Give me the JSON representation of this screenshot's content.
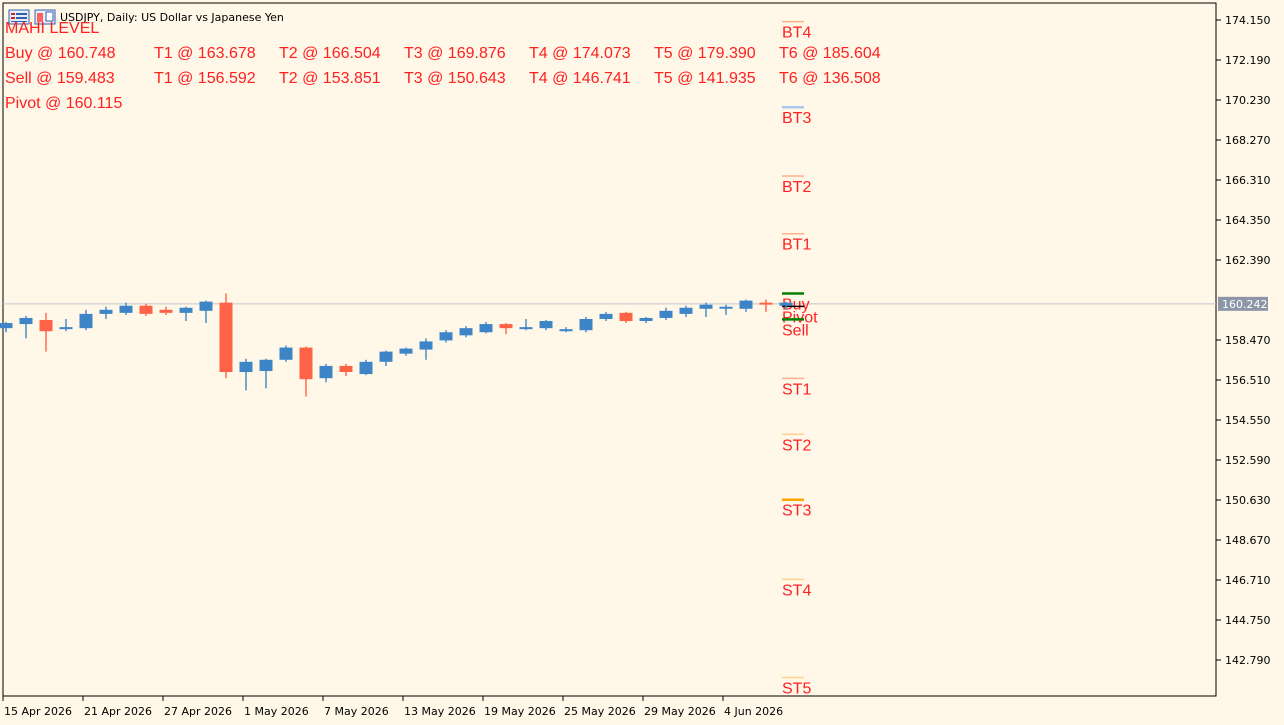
{
  "header": {
    "symbol_title": "USDJPY, Daily:  US Dollar vs Japanese Yen",
    "indicator_name": "MAHI LEVEL",
    "icons": [
      "indicator-list-icon",
      "chart-window-icon"
    ]
  },
  "levels_panel": {
    "rows": [
      [
        "Buy @ 160.748",
        "T1 @ 163.678",
        "T2 @ 166.504",
        "T3 @ 169.876",
        "T4 @ 174.073",
        "T5 @ 179.390",
        "T6 @ 185.604"
      ],
      [
        "Sell @ 159.483",
        "T1 @ 156.592",
        "T2 @ 153.851",
        "T3 @ 150.643",
        "T4 @ 146.741",
        "T5 @ 141.935",
        "T6 @ 136.508"
      ],
      [
        "Pivot @ 160.115"
      ]
    ]
  },
  "colors": {
    "background": "#fff8e8",
    "bull": "#3d85c6",
    "bear": "#ff6347",
    "level_text": "#ff2020",
    "current_price_bg": "#8c96a8",
    "buy_line": "#008000",
    "st3_line": "#ffa500"
  },
  "chart_data": {
    "type": "candlestick",
    "title": "USDJPY, Daily:  US Dollar vs Japanese Yen",
    "ylim": [
      141.2,
      175.6
    ],
    "yticks": [
      174.15,
      172.19,
      170.23,
      168.27,
      166.31,
      164.35,
      162.39,
      158.47,
      156.51,
      154.55,
      152.59,
      150.63,
      148.67,
      146.71,
      144.75,
      142.79
    ],
    "ytick_labels": [
      "174.150",
      "172.190",
      "170.230",
      "168.270",
      "166.310",
      "164.350",
      "162.390",
      "158.470",
      "156.510",
      "154.550",
      "152.590",
      "150.630",
      "148.670",
      "146.710",
      "144.750",
      "142.790"
    ],
    "current_price": 160.242,
    "current_price_label": "160.242",
    "xtick_labels": [
      "15 Apr 2026",
      "21 Apr 2026",
      "27 Apr 2026",
      "1 May 2026",
      "7 May 2026",
      "13 May 2026",
      "19 May 2026",
      "25 May 2026",
      "29 May 2026",
      "4 Jun 2026"
    ],
    "candles": [
      {
        "o": 159.05,
        "h": 159.35,
        "l": 158.85,
        "c": 159.3
      },
      {
        "o": 159.25,
        "h": 159.65,
        "l": 158.55,
        "c": 159.55
      },
      {
        "o": 159.45,
        "h": 159.8,
        "l": 157.9,
        "c": 158.9
      },
      {
        "o": 159.05,
        "h": 159.5,
        "l": 158.9,
        "c": 159.1
      },
      {
        "o": 159.05,
        "h": 159.95,
        "l": 158.95,
        "c": 159.75
      },
      {
        "o": 159.75,
        "h": 160.1,
        "l": 159.5,
        "c": 159.95
      },
      {
        "o": 159.8,
        "h": 160.3,
        "l": 159.7,
        "c": 160.15
      },
      {
        "o": 160.15,
        "h": 160.25,
        "l": 159.65,
        "c": 159.75
      },
      {
        "o": 159.95,
        "h": 160.1,
        "l": 159.7,
        "c": 159.8
      },
      {
        "o": 159.8,
        "h": 160.1,
        "l": 159.4,
        "c": 160.05
      },
      {
        "o": 159.9,
        "h": 160.4,
        "l": 159.3,
        "c": 160.35
      },
      {
        "o": 160.3,
        "h": 160.75,
        "l": 156.6,
        "c": 156.9
      },
      {
        "o": 156.9,
        "h": 157.55,
        "l": 156.0,
        "c": 157.4
      },
      {
        "o": 156.95,
        "h": 157.55,
        "l": 156.1,
        "c": 157.5
      },
      {
        "o": 157.5,
        "h": 158.2,
        "l": 157.4,
        "c": 158.1
      },
      {
        "o": 158.1,
        "h": 158.15,
        "l": 155.7,
        "c": 156.55
      },
      {
        "o": 156.6,
        "h": 157.3,
        "l": 156.4,
        "c": 157.2
      },
      {
        "o": 157.2,
        "h": 157.3,
        "l": 156.7,
        "c": 156.9
      },
      {
        "o": 156.8,
        "h": 157.5,
        "l": 156.75,
        "c": 157.4
      },
      {
        "o": 157.4,
        "h": 157.95,
        "l": 157.2,
        "c": 157.9
      },
      {
        "o": 157.8,
        "h": 158.1,
        "l": 157.7,
        "c": 158.05
      },
      {
        "o": 158.0,
        "h": 158.55,
        "l": 157.5,
        "c": 158.4
      },
      {
        "o": 158.45,
        "h": 158.95,
        "l": 158.35,
        "c": 158.85
      },
      {
        "o": 158.7,
        "h": 159.15,
        "l": 158.6,
        "c": 159.05
      },
      {
        "o": 158.85,
        "h": 159.35,
        "l": 158.8,
        "c": 159.25
      },
      {
        "o": 159.25,
        "h": 159.3,
        "l": 158.75,
        "c": 159.05
      },
      {
        "o": 159.05,
        "h": 159.5,
        "l": 158.95,
        "c": 159.1
      },
      {
        "o": 159.05,
        "h": 159.45,
        "l": 158.95,
        "c": 159.4
      },
      {
        "o": 158.9,
        "h": 159.1,
        "l": 158.85,
        "c": 159.0
      },
      {
        "o": 158.95,
        "h": 159.6,
        "l": 158.85,
        "c": 159.5
      },
      {
        "o": 159.5,
        "h": 159.85,
        "l": 159.4,
        "c": 159.75
      },
      {
        "o": 159.8,
        "h": 159.85,
        "l": 159.3,
        "c": 159.4
      },
      {
        "o": 159.4,
        "h": 159.6,
        "l": 159.3,
        "c": 159.55
      },
      {
        "o": 159.55,
        "h": 160.05,
        "l": 159.45,
        "c": 159.9
      },
      {
        "o": 159.75,
        "h": 160.15,
        "l": 159.6,
        "c": 160.05
      },
      {
        "o": 160.0,
        "h": 160.3,
        "l": 159.6,
        "c": 160.2
      },
      {
        "o": 160.05,
        "h": 160.2,
        "l": 159.7,
        "c": 160.1
      },
      {
        "o": 160.0,
        "h": 160.45,
        "l": 159.85,
        "c": 160.4
      },
      {
        "o": 160.3,
        "h": 160.45,
        "l": 159.85,
        "c": 160.25
      },
      {
        "o": 160.15,
        "h": 160.35,
        "l": 159.95,
        "c": 160.3
      }
    ],
    "levels": [
      {
        "label": "BT4",
        "value": 174.073,
        "line_color": "#ffb08a"
      },
      {
        "label": "BT3",
        "value": 169.876,
        "line_color": "#a8c8ec"
      },
      {
        "label": "BT2",
        "value": 166.504,
        "line_color": "#ffb08a"
      },
      {
        "label": "BT1",
        "value": 163.678,
        "line_color": "#ffb08a"
      },
      {
        "label": "Buy",
        "value": 160.748,
        "line_color": "#008000"
      },
      {
        "label": "Pivot",
        "value": 160.115,
        "line_color": "#000000"
      },
      {
        "label": "Sell",
        "value": 159.483,
        "line_color": "#008000"
      },
      {
        "label": "ST1",
        "value": 156.592,
        "line_color": "#ffb08a"
      },
      {
        "label": "ST2",
        "value": 153.851,
        "line_color": "#ffd090"
      },
      {
        "label": "ST3",
        "value": 150.643,
        "line_color": "#ffa500"
      },
      {
        "label": "ST4",
        "value": 146.741,
        "line_color": "#ffd090"
      },
      {
        "label": "ST5",
        "value": 141.935,
        "line_color": "#ffd090"
      }
    ]
  }
}
